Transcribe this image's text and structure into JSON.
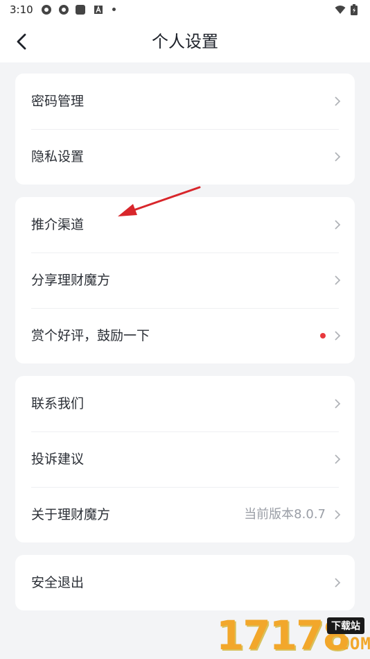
{
  "status_bar": {
    "time": "3:10",
    "icons": [
      "gear-icon",
      "gear-icon",
      "app-square-icon",
      "a-badge-icon",
      "dot-icon",
      "wifi-icon",
      "battery-icon"
    ]
  },
  "header": {
    "title": "个人设置",
    "back_icon": "chevron-left-icon"
  },
  "sections": [
    {
      "items": [
        {
          "label": "密码管理"
        },
        {
          "label": "隐私设置"
        }
      ]
    },
    {
      "items": [
        {
          "label": "推介渠道"
        },
        {
          "label": "分享理财魔方"
        },
        {
          "label": "赏个好评，鼓励一下",
          "badge": "red-dot"
        }
      ]
    },
    {
      "items": [
        {
          "label": "联系我们"
        },
        {
          "label": "投诉建议"
        },
        {
          "label": "关于理财魔方",
          "value": "当前版本8.0.7"
        }
      ]
    },
    {
      "items": [
        {
          "label": "安全退出"
        }
      ]
    }
  ],
  "annotation": {
    "icon": "red-arrow-icon",
    "color": "#d8262b"
  },
  "watermark": {
    "number": "17178",
    "tag": "下载站",
    "suffix": ".COM"
  },
  "colors": {
    "background": "#f3f4f6",
    "card": "#ffffff",
    "text": "#2b2f36",
    "muted": "#9a9ea6",
    "badge": "#e8383d"
  }
}
